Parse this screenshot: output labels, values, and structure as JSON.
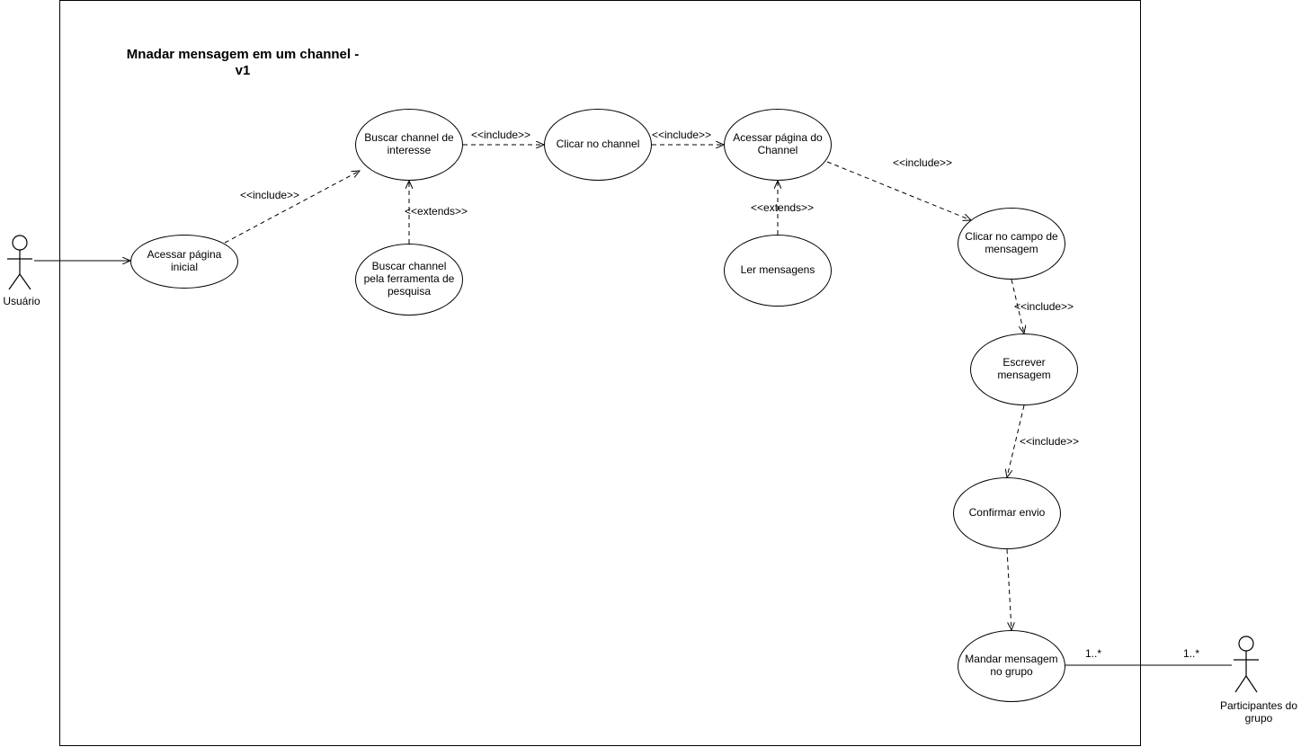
{
  "diagram": {
    "title": "Mnadar mensagem em um channel - v1",
    "actors": {
      "usuario": "Usuário",
      "participantes": "Participantes do grupo"
    },
    "usecases": {
      "acessar_inicial": "Acessar página inicial",
      "buscar_interesse": "Buscar channel de interesse",
      "buscar_pesquisa": "Buscar channel pela ferramenta de pesquisa",
      "clicar_channel": "Clicar no channel",
      "acessar_channel": "Acessar página do Channel",
      "ler_mensagens": "Ler mensagens",
      "clicar_campo": "Clicar no campo de mensagem",
      "escrever": "Escrever mensagem",
      "confirmar": "Confirmar envio",
      "mandar_grupo": "Mandar mensagem no grupo"
    },
    "stereotypes": {
      "include": "<<include>>",
      "extends": "<<extends>>"
    },
    "multiplicity": {
      "one_many": "1..*"
    }
  }
}
